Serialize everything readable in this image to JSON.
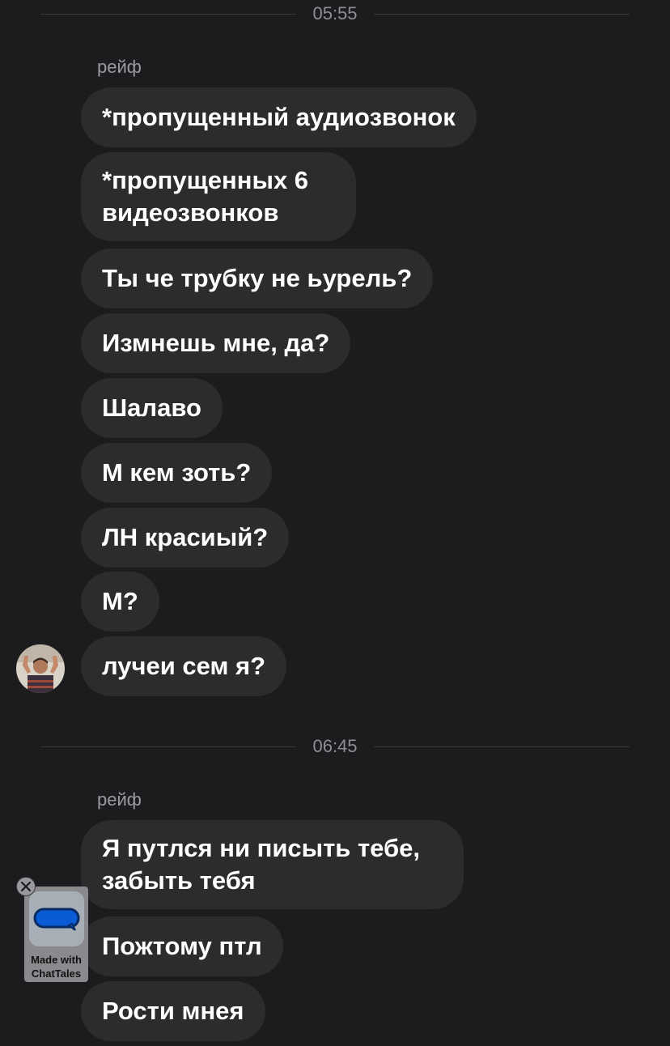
{
  "groups": [
    {
      "time": "05:55",
      "sender": "рейф",
      "messages": [
        "*пропущенный аудиозвонок",
        "*пропущенных 6 видеозвонков",
        "Ты че трубку не ьурель?",
        "Измнешь мне, да?",
        "Шалаво",
        "М кем зоть?",
        "ЛН красиый?",
        "М?",
        "лучеи сем я?"
      ]
    },
    {
      "time": "06:45",
      "sender": "рейф",
      "messages": [
        "Я путлся ни писыть тебе, забыть тебя",
        "Пожтому птл",
        "Рости мнея"
      ]
    }
  ],
  "watermark": {
    "label_line1": "Made with",
    "label_line2": "ChatTales",
    "icon": "chat-bubble-icon",
    "close_icon": "close-icon"
  },
  "colors": {
    "background": "#1c1c1e",
    "bubble": "#2c2c2e",
    "text": "#ffffff",
    "meta": "#8e8e93",
    "badge_accent": "#0a5bd6"
  }
}
